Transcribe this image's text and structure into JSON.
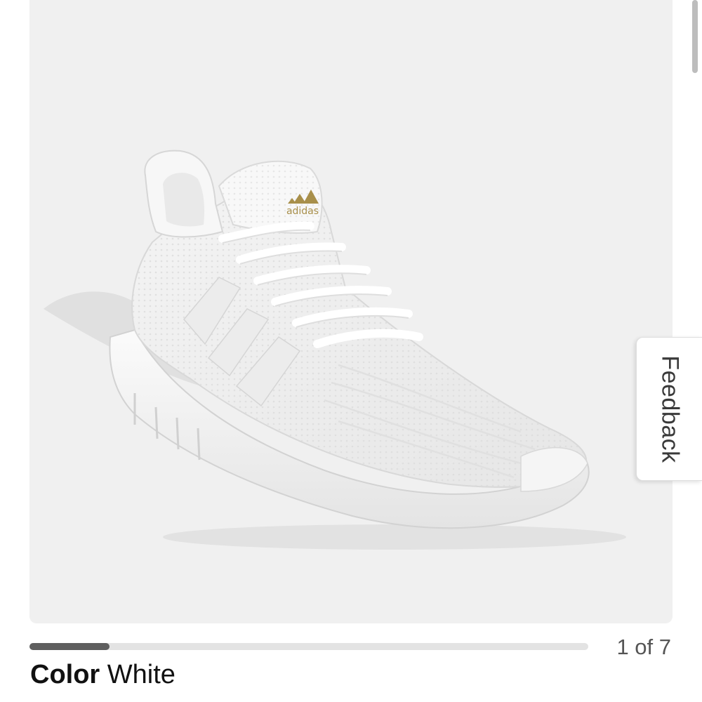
{
  "product": {
    "image_alt": "White running sneaker",
    "brand_mark": "adidas",
    "colors": {
      "background": "#f0f0f0",
      "shoe": "#ffffff",
      "logo": "#a88f4a"
    }
  },
  "gallery": {
    "current": 1,
    "total": 7,
    "pager_text": "1 of 7",
    "progress_fraction": 0.142857
  },
  "color_selector": {
    "label": "Color",
    "value": "White"
  },
  "feedback": {
    "label": "Feedback"
  }
}
